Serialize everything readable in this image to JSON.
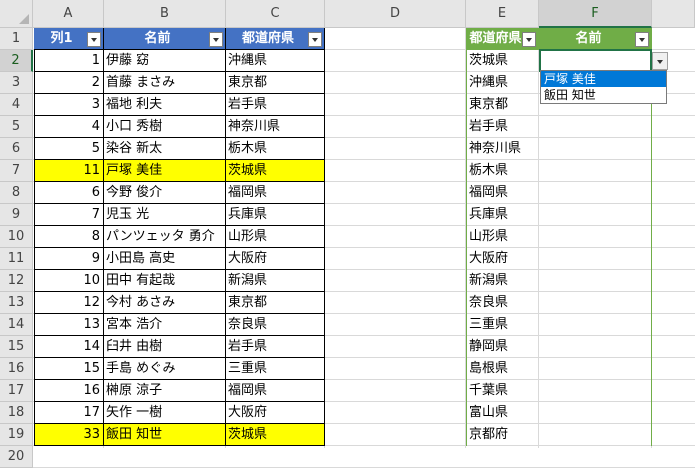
{
  "columns": [
    "A",
    "B",
    "C",
    "D",
    "E",
    "F"
  ],
  "row_numbers": [
    "1",
    "2",
    "3",
    "4",
    "5",
    "6",
    "7",
    "8",
    "9",
    "10",
    "11",
    "12",
    "13",
    "14",
    "15",
    "16",
    "17",
    "18",
    "19",
    "20"
  ],
  "table1": {
    "headers": [
      "列1",
      "名前",
      "都道府県"
    ],
    "rows": [
      {
        "n": "1",
        "name": "伊藤 窈",
        "pref": "沖縄県",
        "hl": false
      },
      {
        "n": "2",
        "name": "首藤 まさみ",
        "pref": "東京都",
        "hl": false
      },
      {
        "n": "3",
        "name": "福地 利夫",
        "pref": "岩手県",
        "hl": false
      },
      {
        "n": "4",
        "name": "小口 秀樹",
        "pref": "神奈川県",
        "hl": false
      },
      {
        "n": "5",
        "name": "染谷 新太",
        "pref": "栃木県",
        "hl": false
      },
      {
        "n": "11",
        "name": "戸塚 美佳",
        "pref": "茨城県",
        "hl": true
      },
      {
        "n": "6",
        "name": "今野 俊介",
        "pref": "福岡県",
        "hl": false
      },
      {
        "n": "7",
        "name": "児玉 光",
        "pref": "兵庫県",
        "hl": false
      },
      {
        "n": "8",
        "name": "パンツェッタ 勇介",
        "pref": "山形県",
        "hl": false
      },
      {
        "n": "9",
        "name": "小田島 高史",
        "pref": "大阪府",
        "hl": false
      },
      {
        "n": "10",
        "name": "田中 有起哉",
        "pref": "新潟県",
        "hl": false
      },
      {
        "n": "12",
        "name": "今村 あさみ",
        "pref": "東京都",
        "hl": false
      },
      {
        "n": "13",
        "name": "宮本 浩介",
        "pref": "奈良県",
        "hl": false
      },
      {
        "n": "14",
        "name": "臼井 由樹",
        "pref": "岩手県",
        "hl": false
      },
      {
        "n": "15",
        "name": "手島 めぐみ",
        "pref": "三重県",
        "hl": false
      },
      {
        "n": "16",
        "name": "榊原 涼子",
        "pref": "福岡県",
        "hl": false
      },
      {
        "n": "17",
        "name": "矢作 一樹",
        "pref": "大阪府",
        "hl": false
      },
      {
        "n": "33",
        "name": "飯田 知世",
        "pref": "茨城県",
        "hl": true
      }
    ]
  },
  "table2": {
    "headers": [
      "都道府県",
      "名前"
    ],
    "prefs": [
      "茨城県",
      "沖縄県",
      "東京都",
      "岩手県",
      "神奈川県",
      "栃木県",
      "福岡県",
      "兵庫県",
      "山形県",
      "大阪府",
      "新潟県",
      "奈良県",
      "三重県",
      "静岡県",
      "島根県",
      "千葉県",
      "富山県",
      "京都府"
    ]
  },
  "dropdown": {
    "options": [
      "戸塚 美佳",
      "飯田 知世"
    ]
  },
  "colors": {
    "table1_header": "#4472c4",
    "table2_header": "#70ad47",
    "highlight": "#ffff00",
    "selection": "#217346",
    "dropdown_highlight": "#0078d7"
  }
}
